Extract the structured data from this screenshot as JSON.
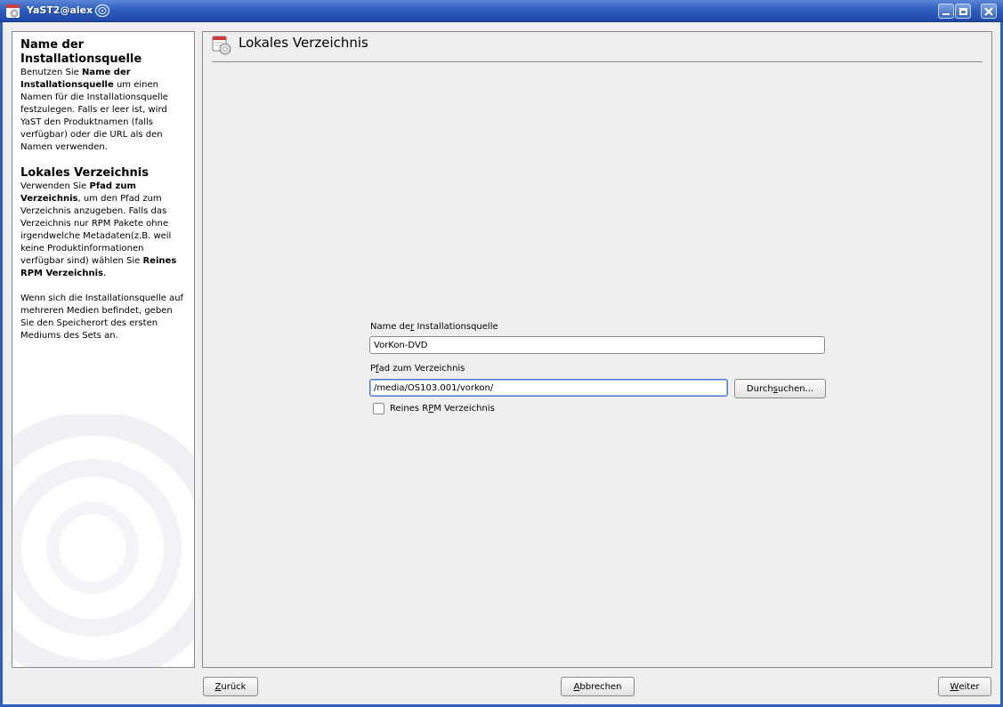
{
  "window": {
    "title": "YaST2@alex",
    "controls": {
      "minimize": "minimize-icon",
      "maximize": "maximize-icon",
      "close": "close-icon"
    }
  },
  "help": {
    "section1": {
      "heading": "Name der Installationsquelle",
      "t1": "Benutzen Sie ",
      "b1": "Name der Installationsquelle",
      "t2": " um einen Namen für die Installationsquelle festzulegen. Falls er leer ist, wird YaST den Produktnamen (falls verfügbar) oder die URL als den Namen verwenden."
    },
    "section2": {
      "heading": "Lokales Verzeichnis",
      "t1": "Verwenden Sie ",
      "b1": "Pfad zum Verzeichnis",
      "t2": ", um den Pfad zum Verzeichnis anzugeben. Falls das Verzeichnis nur RPM Pakete ohne irgendwelche Metadaten(z.B. weil keine Produktinformationen verfügbar sind) wählen Sie ",
      "b2": "Reines RPM Verzeichnis",
      "t3": ".",
      "p2": "Wenn sich die Installationsquelle auf mehreren Medien befindet, geben Sie den Speicherort des ersten Mediums des Sets an."
    }
  },
  "main": {
    "title": "Lokales Verzeichnis",
    "name_field": {
      "label_pre": "Name de",
      "label_key": "r",
      "label_post": " Installationsquelle",
      "value": "VorKon-DVD"
    },
    "path_field": {
      "label_pre": "P",
      "label_key": "f",
      "label_post": "ad zum Verzeichnis",
      "value": "/media/OS103.001/vorkon/"
    },
    "browse_button": {
      "pre": "Durch",
      "key": "s",
      "post": "uchen..."
    },
    "rpm_checkbox": {
      "pre": "Reines R",
      "key": "P",
      "post": "M Verzeichnis",
      "checked": false
    }
  },
  "footer": {
    "back": {
      "key": "Z",
      "post": "urück"
    },
    "abort": {
      "key": "A",
      "post": "bbrechen"
    },
    "next": {
      "key": "W",
      "post": "eiter"
    }
  }
}
